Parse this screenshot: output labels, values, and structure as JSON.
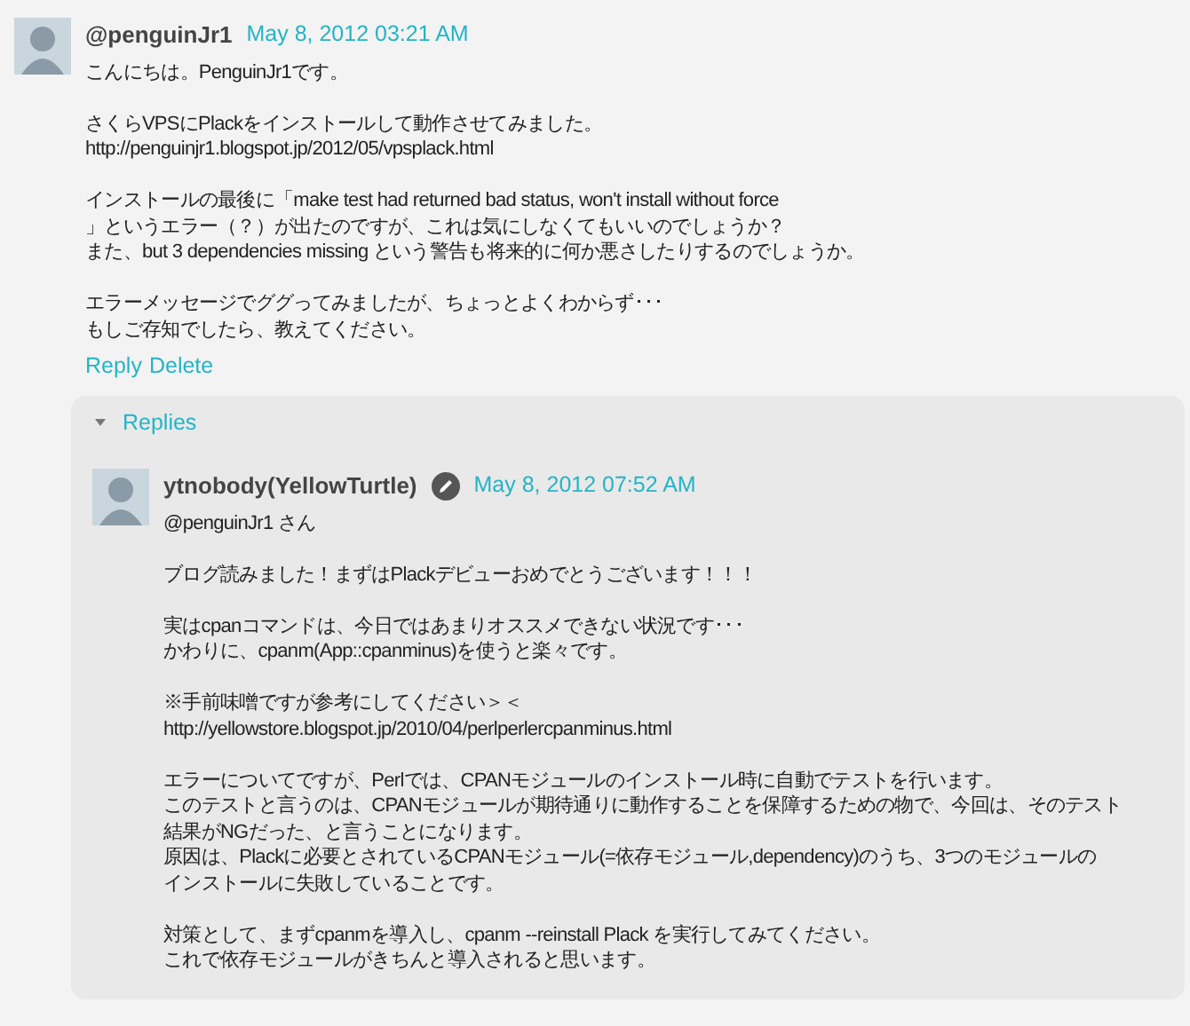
{
  "comment": {
    "author": "@penguinJr1",
    "date": "May 8, 2012 03:21 AM",
    "paragraphs": [
      [
        "こんにちは。PenguinJr1です。"
      ],
      [
        "さくらVPSにPlackをインストールして動作させてみました。",
        "http://penguinjr1.blogspot.jp/2012/05/vpsplack.html"
      ],
      [
        "インストールの最後に「make test had returned bad status, won't install without force",
        "」というエラー（？）が出たのですが、これは気にしなくてもいいのでしょうか？",
        "また、but 3 dependencies missing  という警告も将来的に何か悪さしたりするのでしょうか。"
      ],
      [
        "エラーメッセージでググってみましたが、ちょっとよくわからず･･･",
        "もしご存知でしたら、教えてください。"
      ]
    ],
    "actions": [
      "Reply",
      "Delete"
    ]
  },
  "replies": {
    "label": "Replies",
    "expanded": true,
    "items": [
      {
        "author": "ytnobody(YellowTurtle)",
        "date": "May 8, 2012 07:52 AM",
        "author_badge": true,
        "paragraphs": [
          [
            "@penguinJr1 さん"
          ],
          [
            "ブログ読みました！まずはPlackデビューおめでとうございます！！！"
          ],
          [
            "実はcpanコマンドは、今日ではあまりオススメできない状況です･･･",
            "かわりに、cpanm(App::cpanminus)を使うと楽々です。"
          ],
          [
            "※手前味噌ですが参考にしてください＞＜",
            "http://yellowstore.blogspot.jp/2010/04/perlperlercpanminus.html"
          ],
          [
            "エラーについてですが、Perlでは、CPANモジュールのインストール時に自動でテストを行います。",
            "このテストと言うのは、CPANモジュールが期待通りに動作することを保障するための物で、今回は、そのテスト",
            "結果がNGだった、と言うことになります。",
            "原因は、Plackに必要とされているCPANモジュール(=依存モジュール,dependency)のうち、3つのモジュールの",
            "インストールに失敗していることです。"
          ],
          [
            "対策として、まずcpanmを導入し、cpanm --reinstall Plack を実行してみてください。",
            "これで依存モジュールがきちんと導入されると思います。"
          ]
        ]
      }
    ]
  }
}
